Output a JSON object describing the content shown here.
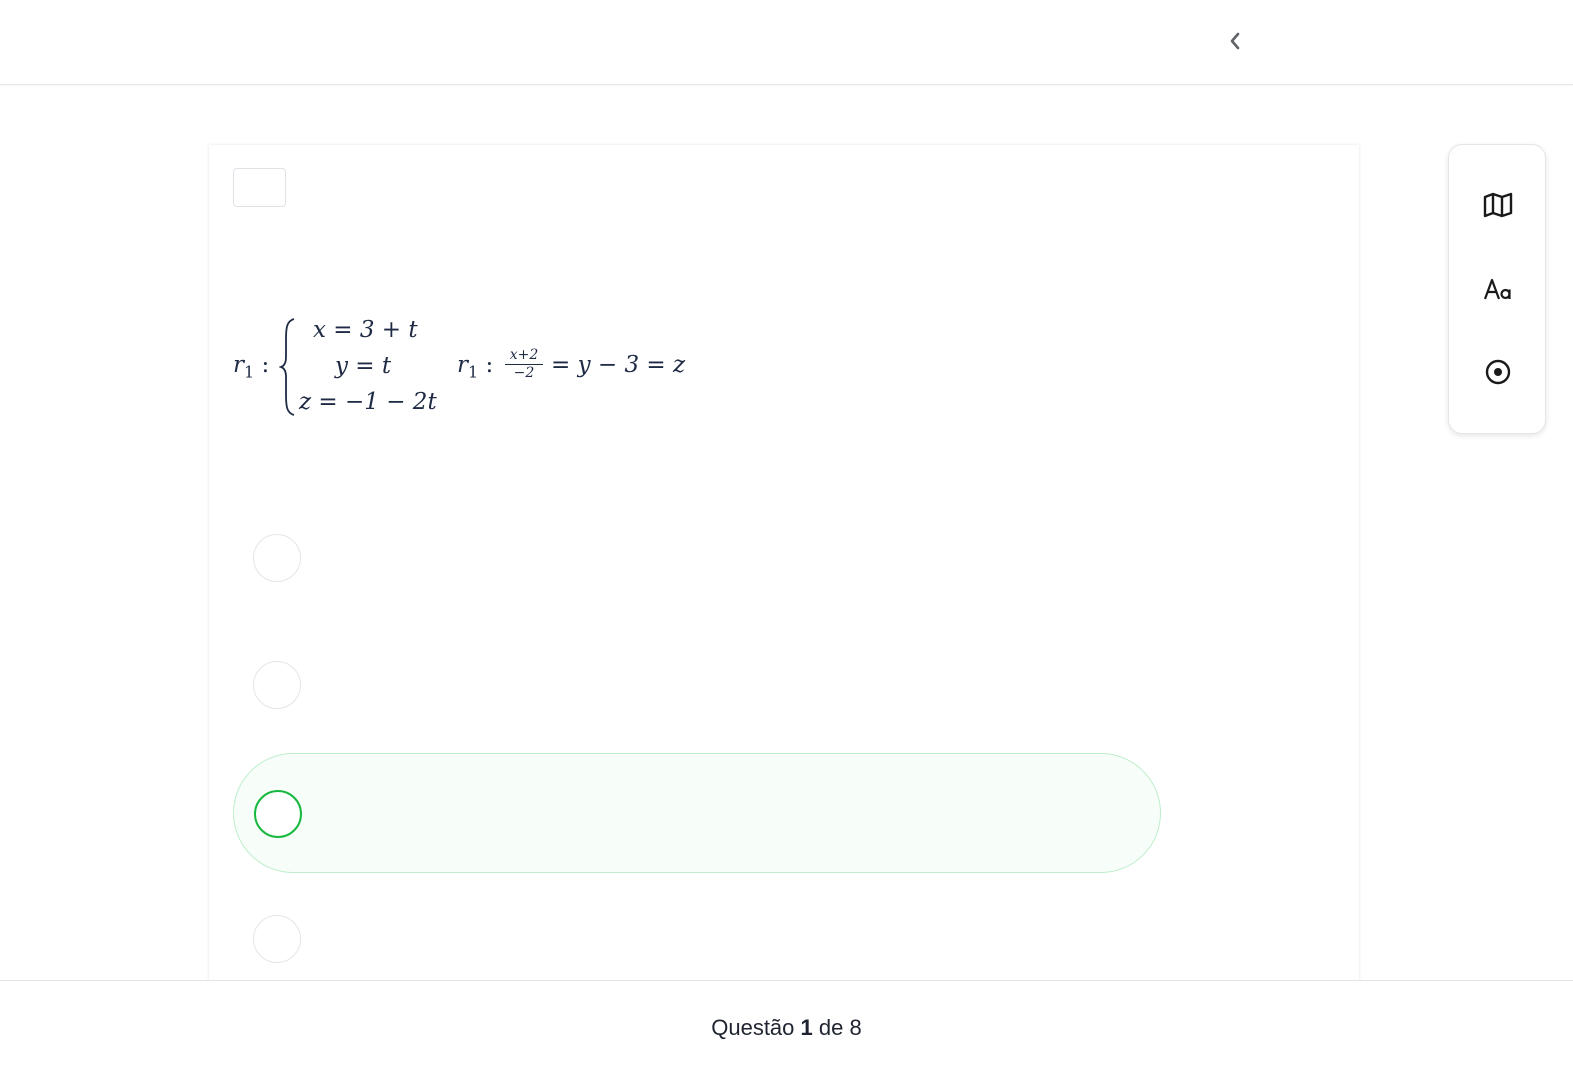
{
  "header": {
    "back_icon": "chevron-left-icon"
  },
  "question": {
    "formula": {
      "r1_label": "r",
      "r1_sub": "1",
      "colon": ":",
      "system": [
        "x = 3 + t",
        "y = t",
        "z = −1 − 2t"
      ],
      "r1b_label": "r",
      "r1b_sub": "1",
      "frac_num": "x+2",
      "frac_den": "−2",
      "rest": "= y − 3 = z"
    },
    "options": [
      {
        "selected": false
      },
      {
        "selected": false
      },
      {
        "selected": true
      },
      {
        "selected": false
      }
    ]
  },
  "toolbar": {
    "icons": [
      "map-icon",
      "font-size-icon",
      "target-icon"
    ]
  },
  "footer": {
    "prefix": "Questão",
    "current": "1",
    "middle": "de",
    "total": "8"
  },
  "colors": {
    "accent": "#17b93e",
    "selected_border": "#bdeecb"
  }
}
